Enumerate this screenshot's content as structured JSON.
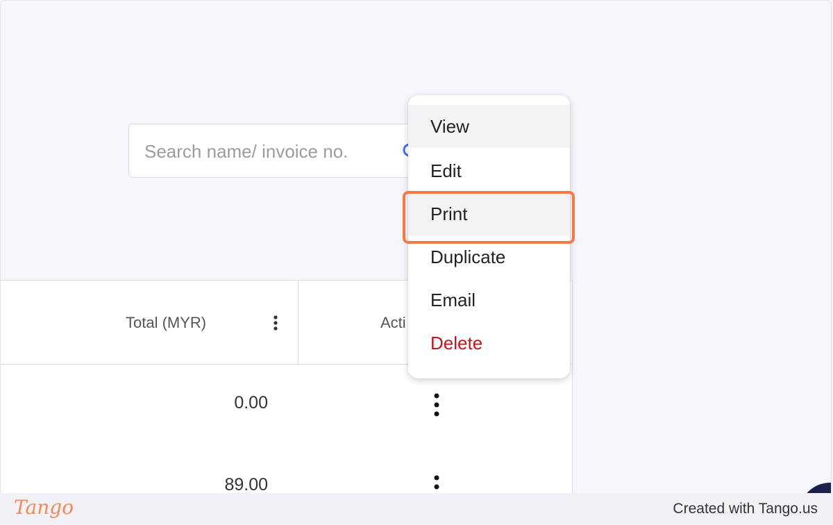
{
  "search": {
    "placeholder": "Search name/ invoice no."
  },
  "table": {
    "columns": {
      "total": "Total (MYR)",
      "action": "Acti"
    },
    "rows": [
      {
        "total": "0.00"
      },
      {
        "total": "89.00"
      }
    ]
  },
  "menu": {
    "items": [
      "View",
      "Edit",
      "Print",
      "Duplicate",
      "Email",
      "Delete"
    ],
    "hovered": "View",
    "highlighted": "Print"
  },
  "colors": {
    "highlight": "#f37a45",
    "danger": "#c3161c",
    "brand": "#f08a5a"
  },
  "footer": {
    "logo": "Tango",
    "credit": "Created with Tango.us"
  }
}
